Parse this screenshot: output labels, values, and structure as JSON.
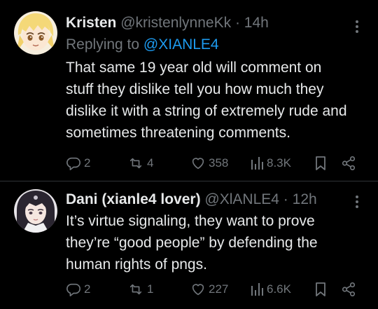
{
  "tweets": [
    {
      "name": "Kristen",
      "handle": "@kristenlynneKk",
      "dot": "·",
      "time": "14h",
      "replying_prefix": "Replying to",
      "replying_to": "@XIANLE4",
      "text": "That same 19 year old will comment on stuff they dislike tell you how much they dislike it with a string of extremely rude and sometimes threatening comments.",
      "replies": "2",
      "retweets": "4",
      "likes": "358",
      "views": "8.3K"
    },
    {
      "name": "Dani (xianle4 lover)",
      "handle": "@XlANLE4",
      "dot": "·",
      "time": "12h",
      "text": "It’s virtue signaling, they want to prove they’re “good people” by defending the human rights of pngs.",
      "replies": "2",
      "retweets": "1",
      "likes": "227",
      "views": "6.6K"
    }
  ],
  "colors": {
    "background": "#000000",
    "text": "#e7e9ea",
    "muted": "#71767b",
    "mention": "#1d9bf0",
    "divider": "#2f3336"
  },
  "icons": [
    "more-icon",
    "reply-icon",
    "retweet-icon",
    "like-icon",
    "views-icon",
    "bookmark-icon",
    "share-icon"
  ]
}
